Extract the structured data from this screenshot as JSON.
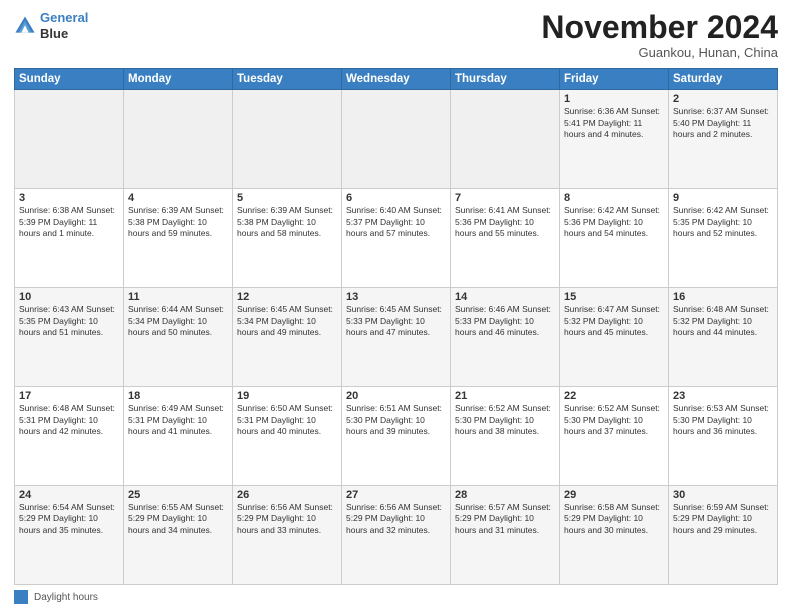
{
  "header": {
    "logo_line1": "General",
    "logo_line2": "Blue",
    "month": "November 2024",
    "location": "Guankou, Hunan, China"
  },
  "weekdays": [
    "Sunday",
    "Monday",
    "Tuesday",
    "Wednesday",
    "Thursday",
    "Friday",
    "Saturday"
  ],
  "weeks": [
    [
      {
        "day": "",
        "info": ""
      },
      {
        "day": "",
        "info": ""
      },
      {
        "day": "",
        "info": ""
      },
      {
        "day": "",
        "info": ""
      },
      {
        "day": "",
        "info": ""
      },
      {
        "day": "1",
        "info": "Sunrise: 6:36 AM\nSunset: 5:41 PM\nDaylight: 11 hours and 4 minutes."
      },
      {
        "day": "2",
        "info": "Sunrise: 6:37 AM\nSunset: 5:40 PM\nDaylight: 11 hours and 2 minutes."
      }
    ],
    [
      {
        "day": "3",
        "info": "Sunrise: 6:38 AM\nSunset: 5:39 PM\nDaylight: 11 hours and 1 minute."
      },
      {
        "day": "4",
        "info": "Sunrise: 6:39 AM\nSunset: 5:38 PM\nDaylight: 10 hours and 59 minutes."
      },
      {
        "day": "5",
        "info": "Sunrise: 6:39 AM\nSunset: 5:38 PM\nDaylight: 10 hours and 58 minutes."
      },
      {
        "day": "6",
        "info": "Sunrise: 6:40 AM\nSunset: 5:37 PM\nDaylight: 10 hours and 57 minutes."
      },
      {
        "day": "7",
        "info": "Sunrise: 6:41 AM\nSunset: 5:36 PM\nDaylight: 10 hours and 55 minutes."
      },
      {
        "day": "8",
        "info": "Sunrise: 6:42 AM\nSunset: 5:36 PM\nDaylight: 10 hours and 54 minutes."
      },
      {
        "day": "9",
        "info": "Sunrise: 6:42 AM\nSunset: 5:35 PM\nDaylight: 10 hours and 52 minutes."
      }
    ],
    [
      {
        "day": "10",
        "info": "Sunrise: 6:43 AM\nSunset: 5:35 PM\nDaylight: 10 hours and 51 minutes."
      },
      {
        "day": "11",
        "info": "Sunrise: 6:44 AM\nSunset: 5:34 PM\nDaylight: 10 hours and 50 minutes."
      },
      {
        "day": "12",
        "info": "Sunrise: 6:45 AM\nSunset: 5:34 PM\nDaylight: 10 hours and 49 minutes."
      },
      {
        "day": "13",
        "info": "Sunrise: 6:45 AM\nSunset: 5:33 PM\nDaylight: 10 hours and 47 minutes."
      },
      {
        "day": "14",
        "info": "Sunrise: 6:46 AM\nSunset: 5:33 PM\nDaylight: 10 hours and 46 minutes."
      },
      {
        "day": "15",
        "info": "Sunrise: 6:47 AM\nSunset: 5:32 PM\nDaylight: 10 hours and 45 minutes."
      },
      {
        "day": "16",
        "info": "Sunrise: 6:48 AM\nSunset: 5:32 PM\nDaylight: 10 hours and 44 minutes."
      }
    ],
    [
      {
        "day": "17",
        "info": "Sunrise: 6:48 AM\nSunset: 5:31 PM\nDaylight: 10 hours and 42 minutes."
      },
      {
        "day": "18",
        "info": "Sunrise: 6:49 AM\nSunset: 5:31 PM\nDaylight: 10 hours and 41 minutes."
      },
      {
        "day": "19",
        "info": "Sunrise: 6:50 AM\nSunset: 5:31 PM\nDaylight: 10 hours and 40 minutes."
      },
      {
        "day": "20",
        "info": "Sunrise: 6:51 AM\nSunset: 5:30 PM\nDaylight: 10 hours and 39 minutes."
      },
      {
        "day": "21",
        "info": "Sunrise: 6:52 AM\nSunset: 5:30 PM\nDaylight: 10 hours and 38 minutes."
      },
      {
        "day": "22",
        "info": "Sunrise: 6:52 AM\nSunset: 5:30 PM\nDaylight: 10 hours and 37 minutes."
      },
      {
        "day": "23",
        "info": "Sunrise: 6:53 AM\nSunset: 5:30 PM\nDaylight: 10 hours and 36 minutes."
      }
    ],
    [
      {
        "day": "24",
        "info": "Sunrise: 6:54 AM\nSunset: 5:29 PM\nDaylight: 10 hours and 35 minutes."
      },
      {
        "day": "25",
        "info": "Sunrise: 6:55 AM\nSunset: 5:29 PM\nDaylight: 10 hours and 34 minutes."
      },
      {
        "day": "26",
        "info": "Sunrise: 6:56 AM\nSunset: 5:29 PM\nDaylight: 10 hours and 33 minutes."
      },
      {
        "day": "27",
        "info": "Sunrise: 6:56 AM\nSunset: 5:29 PM\nDaylight: 10 hours and 32 minutes."
      },
      {
        "day": "28",
        "info": "Sunrise: 6:57 AM\nSunset: 5:29 PM\nDaylight: 10 hours and 31 minutes."
      },
      {
        "day": "29",
        "info": "Sunrise: 6:58 AM\nSunset: 5:29 PM\nDaylight: 10 hours and 30 minutes."
      },
      {
        "day": "30",
        "info": "Sunrise: 6:59 AM\nSunset: 5:29 PM\nDaylight: 10 hours and 29 minutes."
      }
    ]
  ],
  "footer": {
    "legend_label": "Daylight hours"
  }
}
